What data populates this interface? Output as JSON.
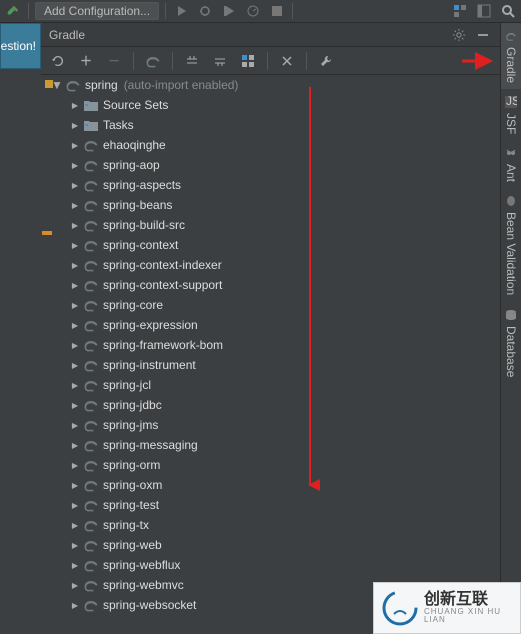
{
  "top_toolbar": {
    "add_config_label": "Add Configuration..."
  },
  "left_strip": {
    "label": "gestion!"
  },
  "panel": {
    "title": "Gradle"
  },
  "tree": {
    "root": {
      "label": "spring",
      "hint": "(auto-import enabled)"
    },
    "children": [
      {
        "label": "Source Sets",
        "icon": "folder"
      },
      {
        "label": "Tasks",
        "icon": "folder"
      },
      {
        "label": "ehaoqinghe",
        "icon": "elephant"
      },
      {
        "label": "spring-aop",
        "icon": "elephant"
      },
      {
        "label": "spring-aspects",
        "icon": "elephant"
      },
      {
        "label": "spring-beans",
        "icon": "elephant"
      },
      {
        "label": "spring-build-src",
        "icon": "elephant"
      },
      {
        "label": "spring-context",
        "icon": "elephant"
      },
      {
        "label": "spring-context-indexer",
        "icon": "elephant"
      },
      {
        "label": "spring-context-support",
        "icon": "elephant"
      },
      {
        "label": "spring-core",
        "icon": "elephant"
      },
      {
        "label": "spring-expression",
        "icon": "elephant"
      },
      {
        "label": "spring-framework-bom",
        "icon": "elephant"
      },
      {
        "label": "spring-instrument",
        "icon": "elephant"
      },
      {
        "label": "spring-jcl",
        "icon": "elephant"
      },
      {
        "label": "spring-jdbc",
        "icon": "elephant"
      },
      {
        "label": "spring-jms",
        "icon": "elephant"
      },
      {
        "label": "spring-messaging",
        "icon": "elephant"
      },
      {
        "label": "spring-orm",
        "icon": "elephant"
      },
      {
        "label": "spring-oxm",
        "icon": "elephant"
      },
      {
        "label": "spring-test",
        "icon": "elephant"
      },
      {
        "label": "spring-tx",
        "icon": "elephant"
      },
      {
        "label": "spring-web",
        "icon": "elephant"
      },
      {
        "label": "spring-webflux",
        "icon": "elephant"
      },
      {
        "label": "spring-webmvc",
        "icon": "elephant"
      },
      {
        "label": "spring-websocket",
        "icon": "elephant"
      }
    ]
  },
  "right_rail": {
    "items": [
      {
        "label": "Gradle"
      },
      {
        "label": "JSF"
      },
      {
        "label": "Ant"
      },
      {
        "label": "Bean Validation"
      },
      {
        "label": "Database"
      }
    ]
  },
  "overlay": {
    "brand_zh": "创新互联",
    "brand_py": "CHUANG XIN HU LIAN"
  }
}
